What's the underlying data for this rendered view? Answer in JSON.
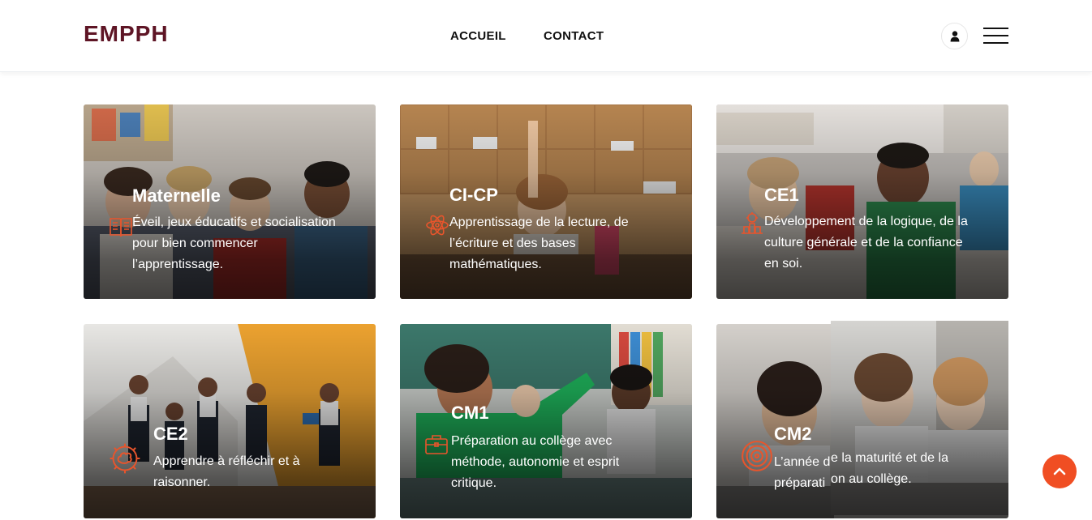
{
  "header": {
    "logo": "EMPPH",
    "nav": [
      {
        "label": "ACCUEIL"
      },
      {
        "label": "CONTACT"
      }
    ],
    "user_icon": "user-icon",
    "menu_icon": "hamburger-menu-icon"
  },
  "colors": {
    "brand": "#5e1525",
    "accent": "#f04e23"
  },
  "cards": [
    {
      "title": "Maternelle",
      "lines": [
        "Éveil, jeux éducatifs et socialisation",
        "pour bien commencer",
        "l’apprentissage."
      ],
      "icon": "book-icon"
    },
    {
      "title": "CI-CP",
      "lines": [
        "Apprentissage de la lecture, de",
        "l’écriture et des bases",
        "mathématiques."
      ],
      "icon": "atom-icon"
    },
    {
      "title": "CE1",
      "lines": [
        "Développement de la logique, de la",
        "culture générale et de la confiance",
        "en soi."
      ],
      "icon": "growth-icon"
    },
    {
      "title": "CE2",
      "lines": [
        "Apprendre à réfléchir et à",
        "raisonner."
      ],
      "icon": "brain-gear-icon"
    },
    {
      "title": "CM1",
      "lines": [
        "Préparation au collège avec",
        "méthode, autonomie et esprit",
        "critique."
      ],
      "icon": "briefcase-icon"
    },
    {
      "title": "CM2",
      "lines": [
        "L’année de",
        "préparati"
      ],
      "icon": "target-icon"
    }
  ],
  "cm2_overlay": {
    "lines": [
      "e la maturité et de la",
      "on au collège."
    ]
  },
  "scroll_top_icon": "chevron-up-icon"
}
